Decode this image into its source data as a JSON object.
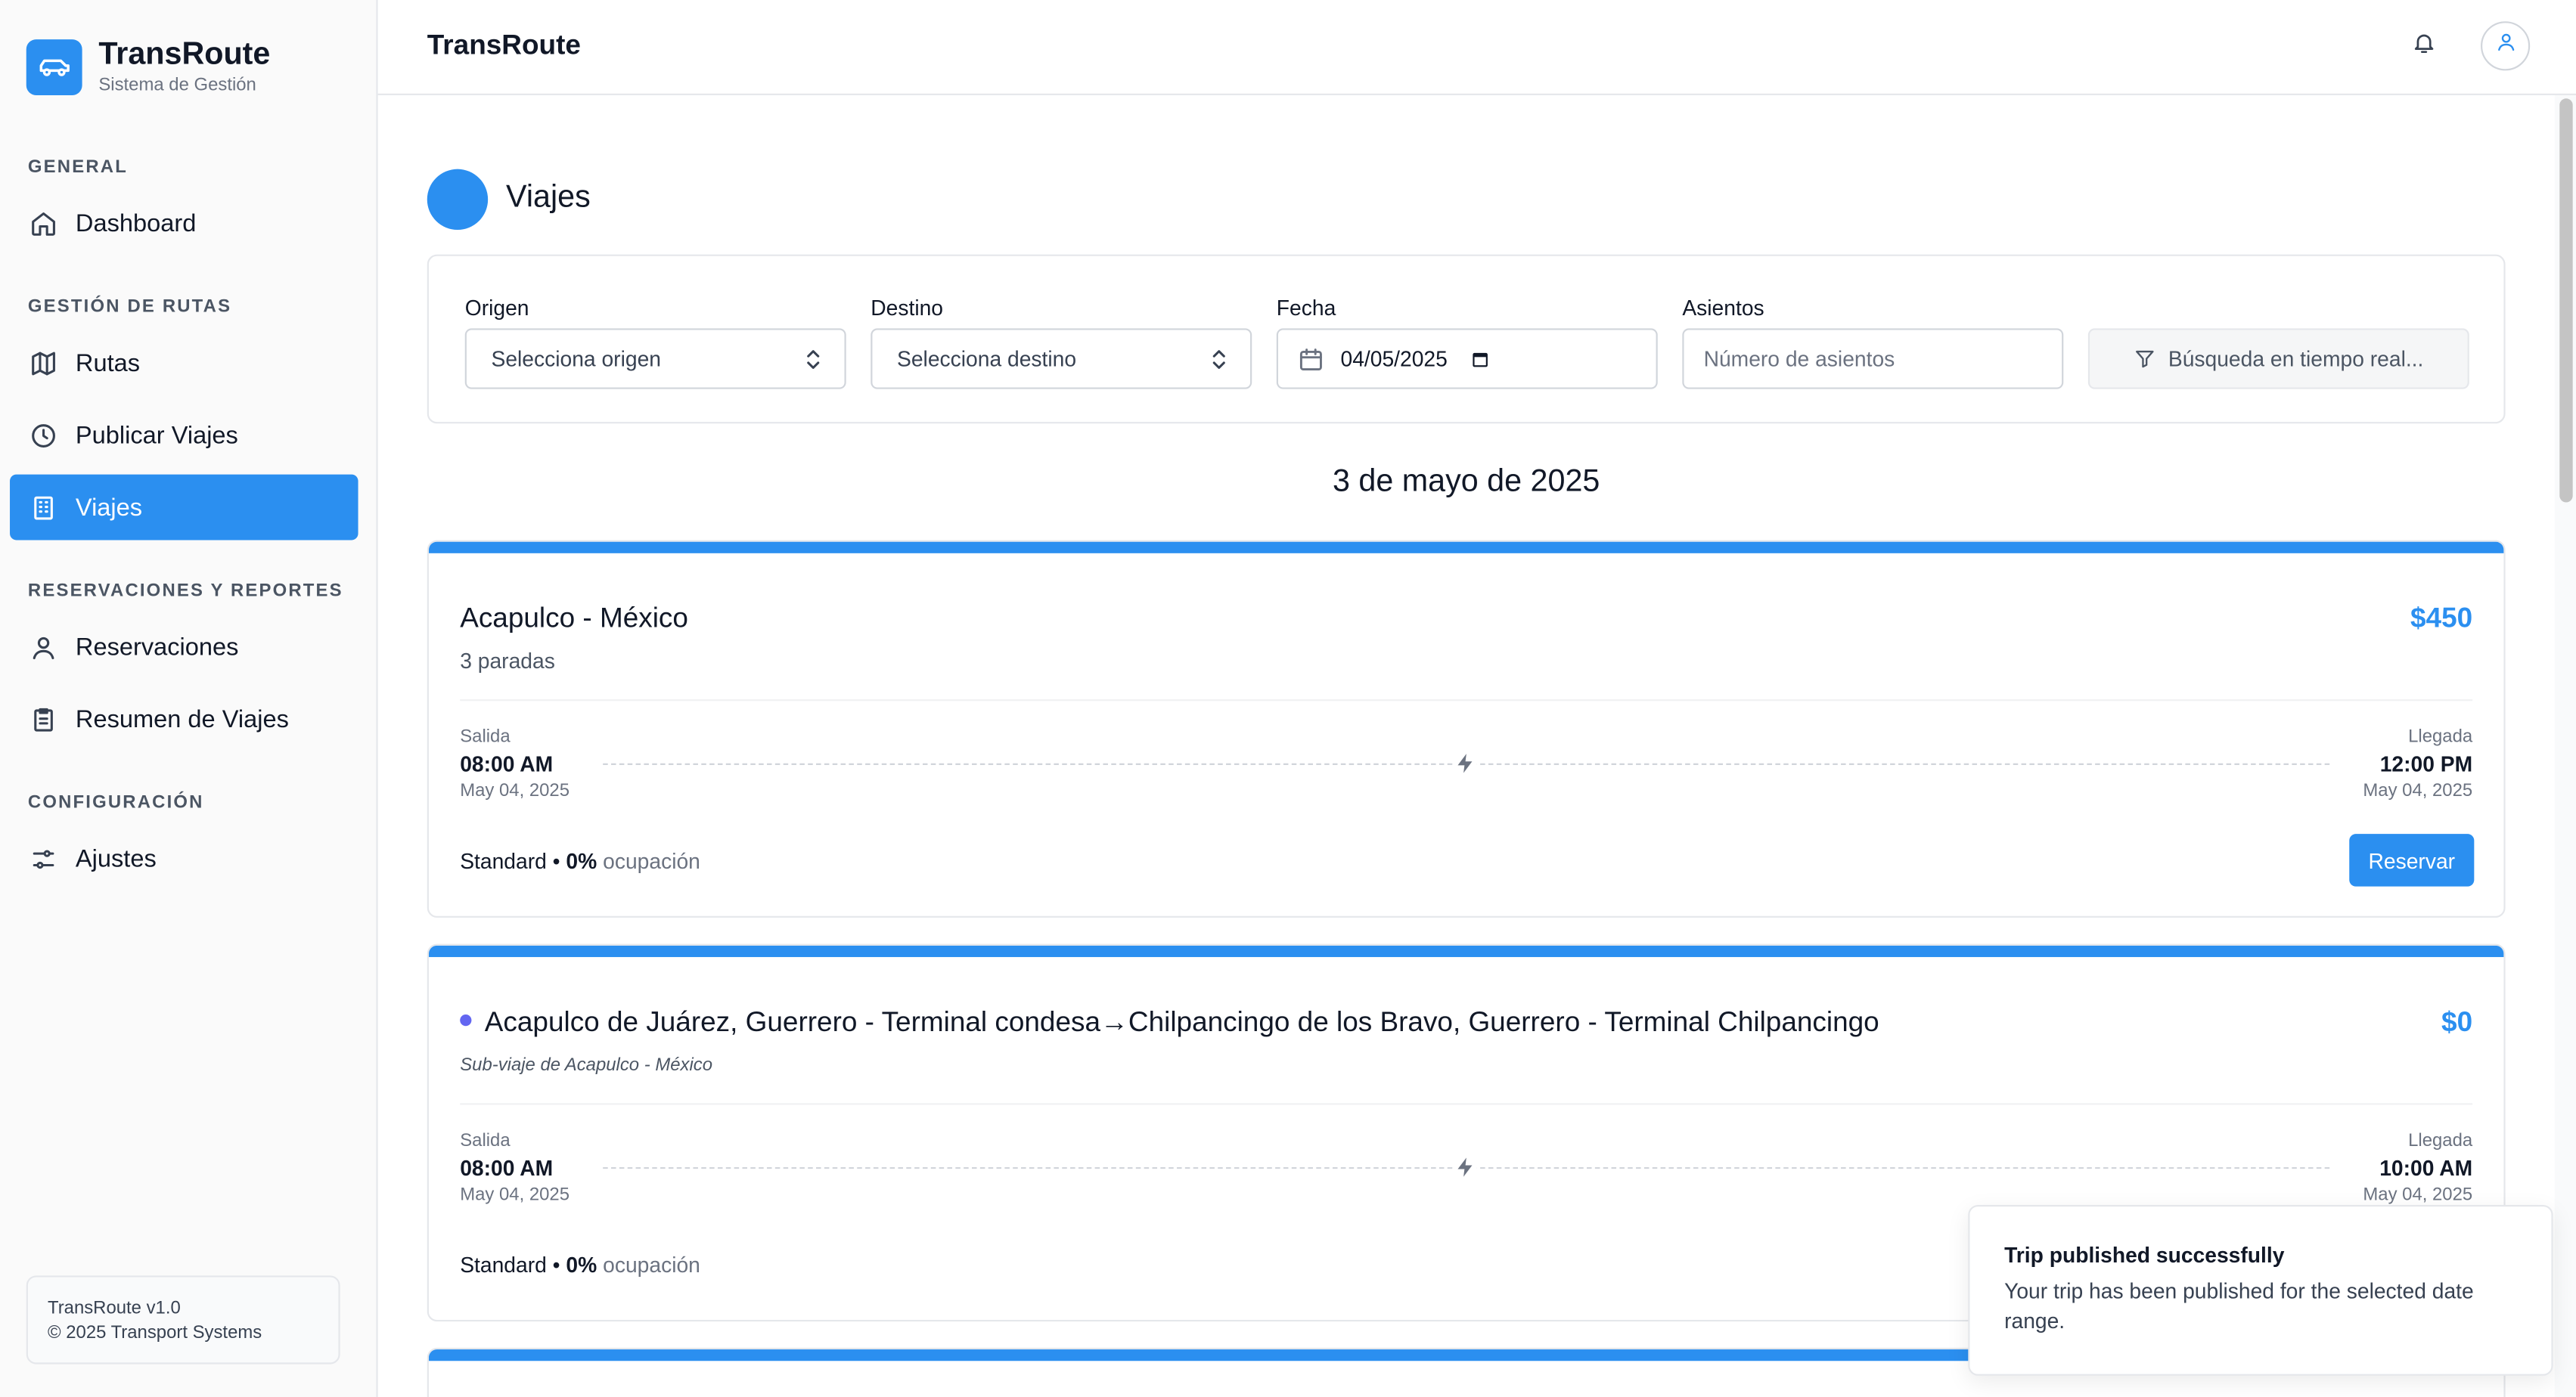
{
  "brand": {
    "title": "TransRoute",
    "subtitle": "Sistema de Gestión"
  },
  "sidebar": {
    "sections": [
      {
        "label": "GENERAL"
      },
      {
        "label": "GESTIÓN DE RUTAS"
      },
      {
        "label": "RESERVACIONES Y REPORTES"
      },
      {
        "label": "CONFIGURACIÓN"
      }
    ],
    "items": [
      {
        "label": "Dashboard",
        "icon": "home-icon"
      },
      {
        "label": "Rutas",
        "icon": "map-icon"
      },
      {
        "label": "Publicar Viajes",
        "icon": "clock-icon"
      },
      {
        "label": "Viajes",
        "icon": "building-icon",
        "active": true
      },
      {
        "label": "Reservaciones",
        "icon": "user-icon"
      },
      {
        "label": "Resumen de Viajes",
        "icon": "clipboard-icon"
      },
      {
        "label": "Ajustes",
        "icon": "sliders-icon"
      }
    ],
    "version": {
      "name": "TransRoute v1.0",
      "copyright": "© 2025 Transport Systems"
    }
  },
  "header": {
    "title": "TransRoute"
  },
  "page": {
    "title": "Viajes"
  },
  "filters": {
    "origin": {
      "label": "Origen",
      "placeholder": "Selecciona origen"
    },
    "destination": {
      "label": "Destino",
      "placeholder": "Selecciona destino"
    },
    "date": {
      "label": "Fecha",
      "value": "04/05/2025"
    },
    "seats": {
      "label": "Asientos",
      "placeholder": "Número de asientos"
    },
    "search_button": "Búsqueda en tiempo real..."
  },
  "date_heading": "3 de mayo de 2025",
  "trips": [
    {
      "title": "Acapulco - México",
      "price": "$450",
      "subtitle": "3 paradas",
      "departure_label": "Salida",
      "departure_time": "08:00 AM",
      "departure_date": "May 04, 2025",
      "arrival_label": "Llegada",
      "arrival_time": "12:00 PM",
      "arrival_date": "May 04, 2025",
      "class": "Standard",
      "occupancy": "0%",
      "occupancy_label": "ocupación",
      "reserve_label": "Reservar"
    },
    {
      "title": "Acapulco de Juárez, Guerrero - Terminal condesa→Chilpancingo de los Bravo, Guerrero - Terminal Chilpancingo",
      "price": "$0",
      "subtitle": "Sub-viaje de Acapulco - México",
      "departure_label": "Salida",
      "departure_time": "08:00 AM",
      "departure_date": "May 04, 2025",
      "arrival_label": "Llegada",
      "arrival_time": "10:00 AM",
      "arrival_date": "May 04, 2025",
      "class": "Standard",
      "occupancy": "0%",
      "occupancy_label": "ocupación"
    }
  ],
  "toast": {
    "title": "Trip published successfully",
    "body": "Your trip has been published for the selected date range."
  },
  "colors": {
    "accent": "#2b8ff0",
    "sub_trip_dot": "#6366f1"
  }
}
